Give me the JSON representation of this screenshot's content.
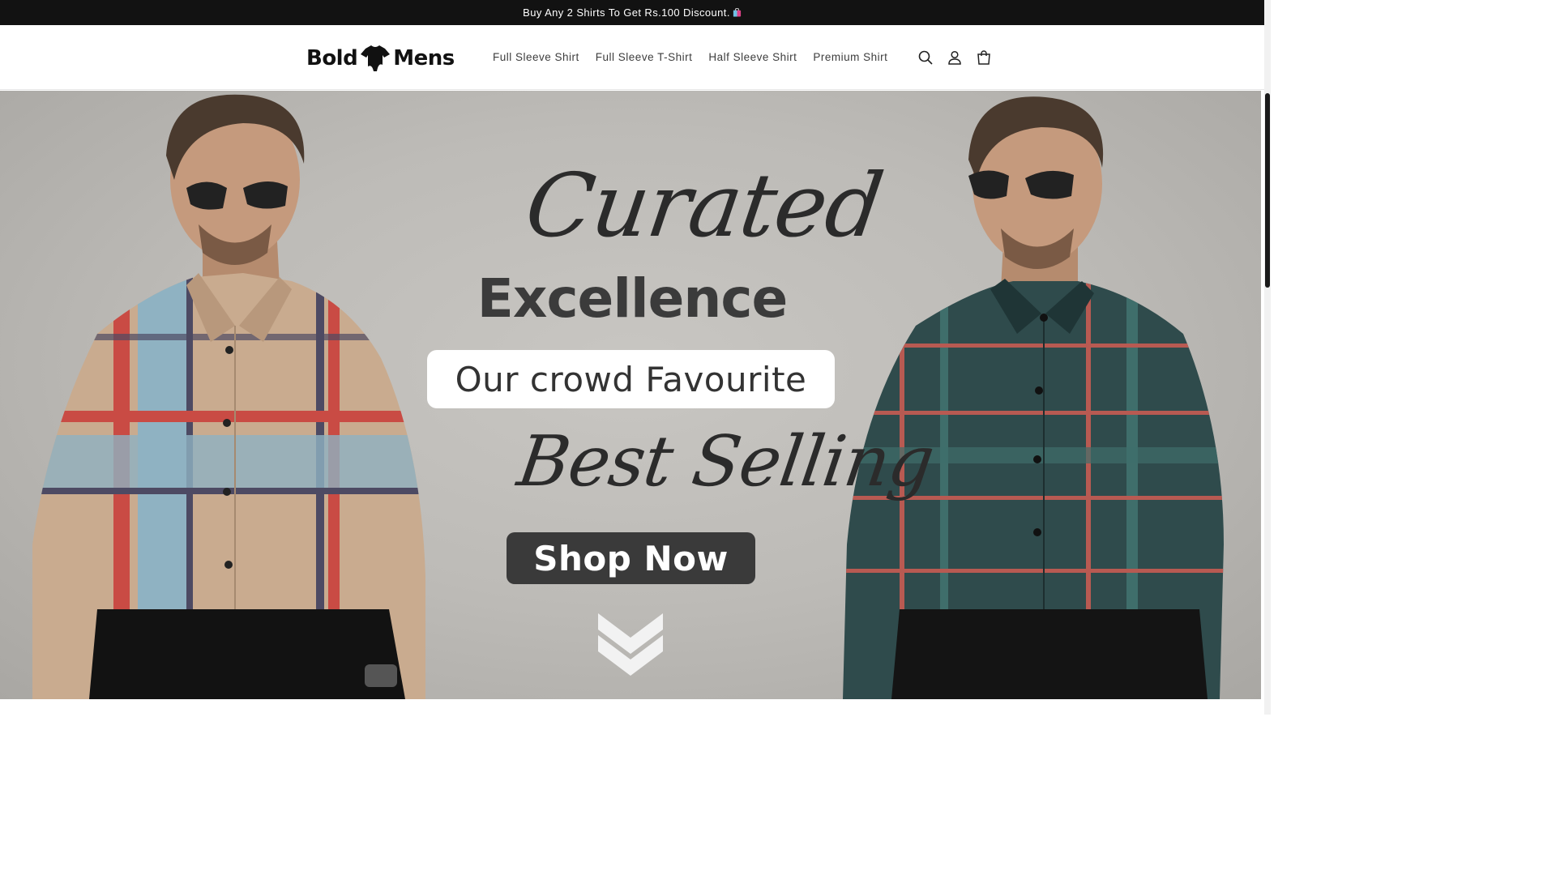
{
  "announcement": {
    "text": "Buy Any 2 Shirts To Get Rs.100 Discount."
  },
  "brand": {
    "name_left": "Bold",
    "name_right": "Mens"
  },
  "nav": {
    "items": [
      {
        "label": "Full Sleeve Shirt"
      },
      {
        "label": "Full Sleeve T-Shirt"
      },
      {
        "label": "Half Sleeve Shirt"
      },
      {
        "label": "Premium Shirt"
      }
    ]
  },
  "header_icons": [
    "search-icon",
    "account-icon",
    "cart-icon"
  ],
  "hero": {
    "script_title": "Curated",
    "headline": "Excellence",
    "tagline": "Our crowd Favourite",
    "script_subtitle": "Best Selling",
    "cta": "Shop Now"
  },
  "colors": {
    "announcement_bg": "#121212",
    "hero_bg": "#bdbbb7",
    "cta_bg": "#3a3a3a",
    "left_shirt": "#c9ab8f",
    "right_shirt": "#2f4b4c"
  }
}
